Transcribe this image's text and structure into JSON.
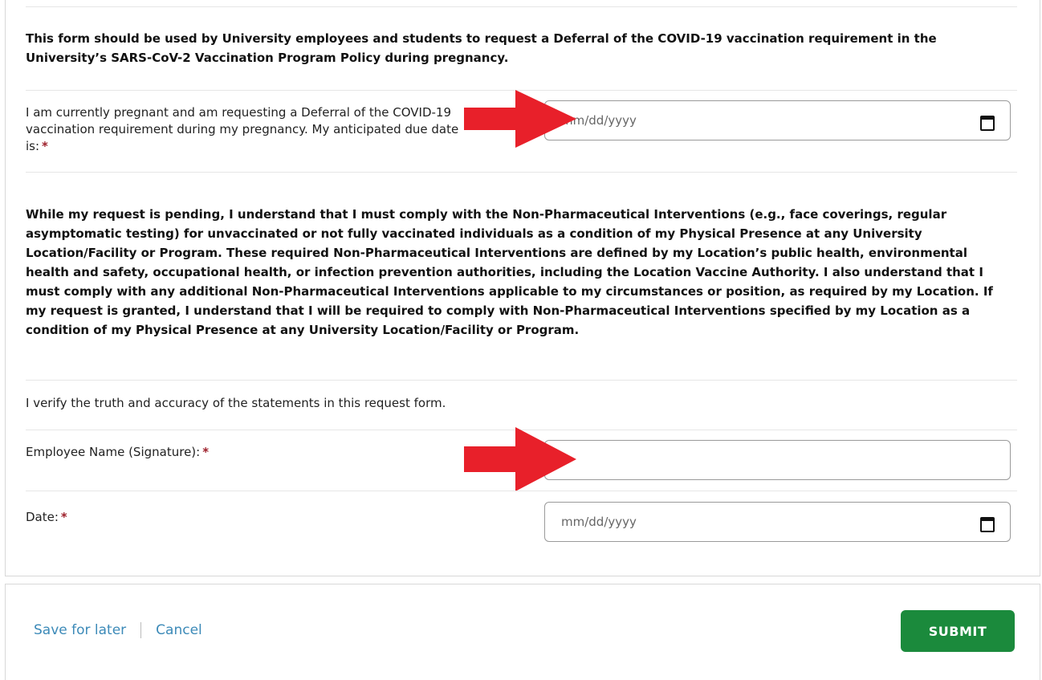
{
  "form": {
    "intro": "This form should be used by University employees and students to request a Deferral of the COVID-19 vaccination requirement in the University’s SARS-CoV-2 Vaccination Program Policy during pregnancy.",
    "due_date_label": "I am currently pregnant and am requesting a Deferral of the COVID-19 vaccination requirement during my pregnancy. My anticipated due date is:",
    "required_mark": "*",
    "due_date_placeholder": "mm/dd/yyyy",
    "policy_text": "While my request is pending, I understand that I must comply with the Non-Pharmaceutical Interventions (e.g., face coverings, regular asymptomatic testing) for unvaccinated or not fully vaccinated individuals as a condition of my Physical Presence at any University Location/Facility or Program. These required Non-Pharmaceutical Interventions are defined by my Location’s public health, environmental health and safety, occupational health, or infection prevention authorities, including the Location Vaccine Authority. I also understand that I must comply with any additional Non-Pharmaceutical Interventions applicable to my circumstances or position, as required by my Location. If my request is granted, I understand that I will be required to comply with Non-Pharmaceutical Interventions specified by my Location as a condition of my Physical Presence at any University Location/Facility or Program.",
    "verify_text": "I verify the truth and accuracy of the statements in this request form.",
    "signature_label": "Employee Name (Signature):",
    "signature_value": "",
    "date_label": "Date:",
    "date_placeholder": "mm/dd/yyyy"
  },
  "footer": {
    "save_label": "Save for later",
    "cancel_label": "Cancel",
    "submit_label": "SUBMIT"
  },
  "colors": {
    "required": "#9d1f2a",
    "link": "#3c8ab8",
    "submit_bg": "#1b8a3c",
    "arrow": "#e8202a"
  },
  "icons": [
    "calendar-icon",
    "arrow-right-icon"
  ]
}
